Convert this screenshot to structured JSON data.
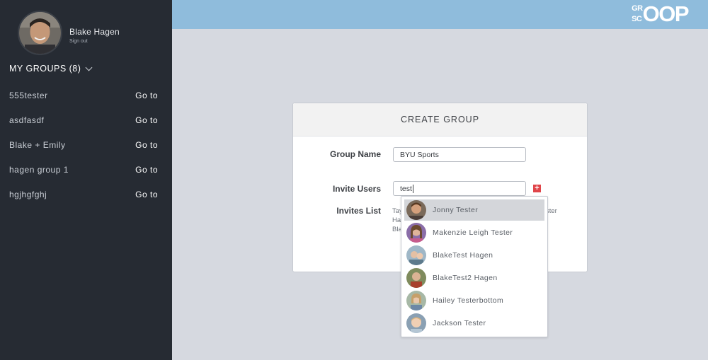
{
  "profile": {
    "name": "Blake Hagen",
    "signout": "Sign out"
  },
  "groups_header": "MY GROUPS (8)",
  "groups": [
    {
      "name": "555tester",
      "action": "Go to"
    },
    {
      "name": "asdfasdf",
      "action": "Go to"
    },
    {
      "name": "Blake + Emily",
      "action": "Go to"
    },
    {
      "name": "hagen group 1",
      "action": "Go to"
    },
    {
      "name": "hgjhgfghj",
      "action": "Go to"
    }
  ],
  "logo": {
    "top": "GR",
    "bottom": "SC",
    "big": "OOP"
  },
  "card": {
    "title": "CREATE GROUP",
    "group_name_label": "Group Name",
    "group_name_value": "BYU Sports",
    "invite_users_label": "Invite Users",
    "invite_users_value": "test",
    "invites_list_label": "Invites List",
    "invites_partial": [
      "Tay",
      "Ha",
      "Bla"
    ],
    "invites_partial_right": "ster",
    "add_icon": "plus-icon"
  },
  "dropdown": [
    {
      "name": "Jonny Tester",
      "active": true
    },
    {
      "name": "Makenzie Leigh Tester",
      "active": false
    },
    {
      "name": "BlakeTest Hagen",
      "active": false
    },
    {
      "name": "BlakeTest2 Hagen",
      "active": false
    },
    {
      "name": "Hailey Testerbottom",
      "active": false
    },
    {
      "name": "Jackson Tester",
      "active": false
    }
  ],
  "colors": {
    "sidebar": "#262b33",
    "topbar": "#8fbcdc",
    "background": "#d6d9e0",
    "add_button": "#e0454a",
    "dropdown_active": "#d4d6da"
  }
}
